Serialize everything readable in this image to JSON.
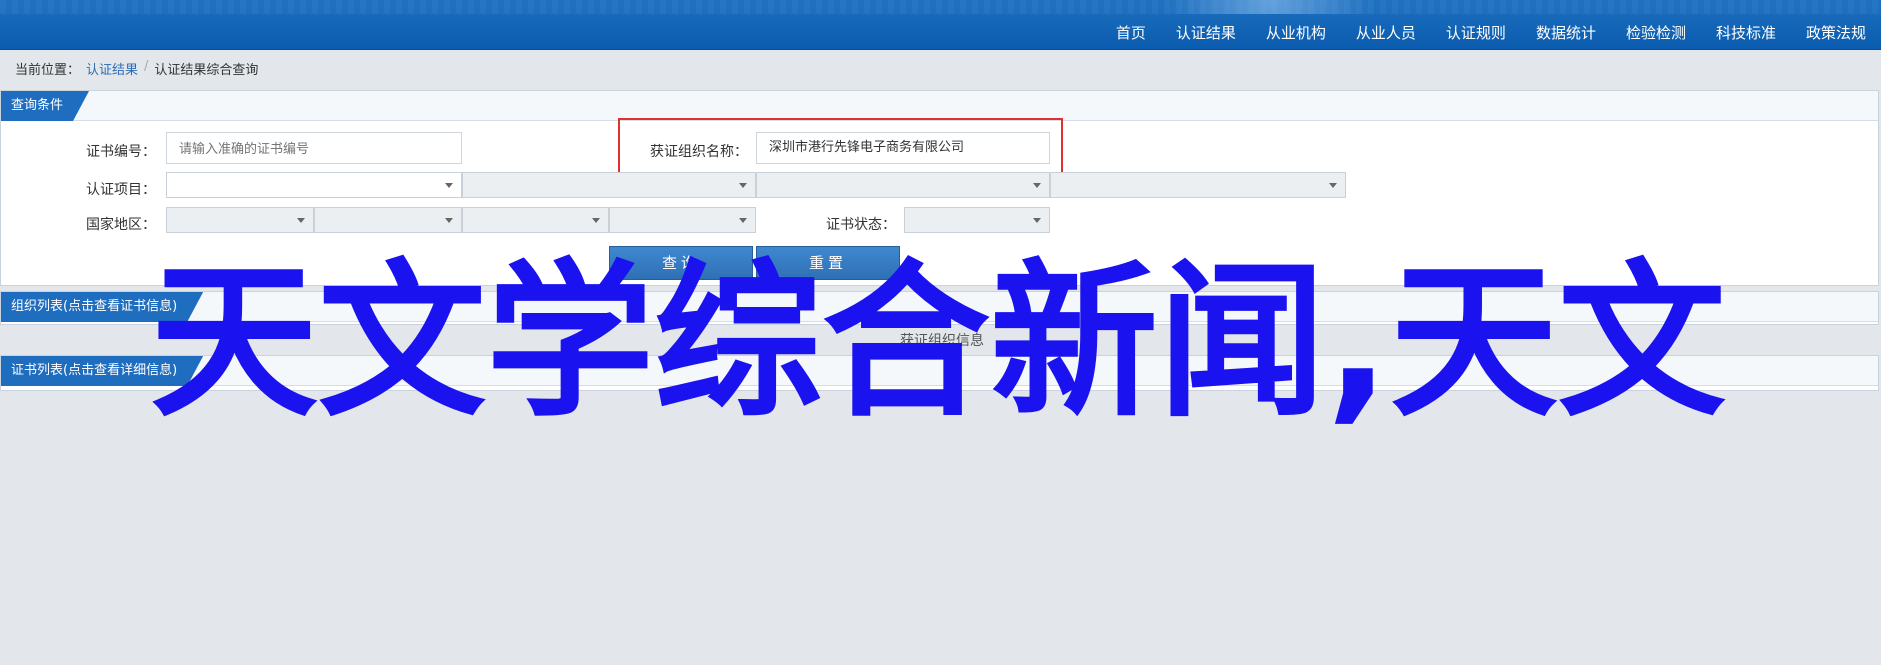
{
  "nav": [
    "首页",
    "认证结果",
    "从业机构",
    "从业人员",
    "认证规则",
    "数据统计",
    "检验检测",
    "科技标准",
    "政策法规"
  ],
  "breadcrumb": {
    "prefix": "当前位置：",
    "link": "认证结果",
    "sep": "/",
    "current": "认证结果综合查询"
  },
  "query": {
    "title": "查询条件",
    "cert_no_label": "证书编号：",
    "cert_no_placeholder": "请输入准确的证书编号",
    "org_label": "获证组织名称：",
    "org_value": "深圳市港行先锋电子商务有限公司",
    "item_label": "认证项目：",
    "region_label": "国家地区：",
    "status_label": "证书状态：",
    "search_button": "查询",
    "reset_button": "重置"
  },
  "org_list": {
    "title": "组织列表(点击查看证书信息)"
  },
  "cert_list": {
    "title": "证书列表(点击查看详细信息)"
  },
  "watermark": "天文学综合新闻,天文",
  "ghost_text": "获证组织信息",
  "colors": {
    "nav_bg": "#0b5cae",
    "accent": "#1f6dbf",
    "highlight": "#e23030",
    "watermark": "#1b13ef"
  }
}
